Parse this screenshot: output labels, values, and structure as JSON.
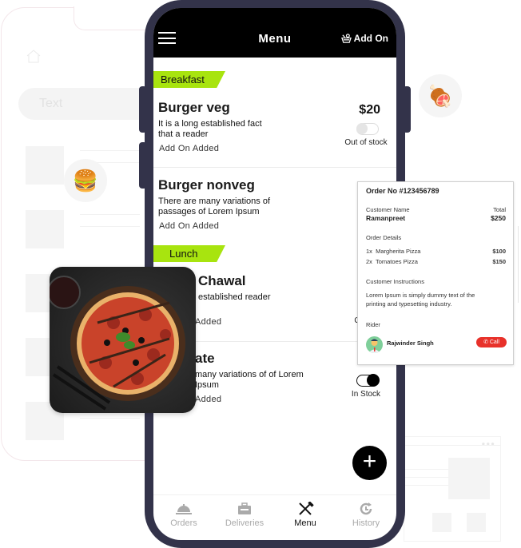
{
  "background": {
    "search_placeholder": "Text",
    "emoji_burger": "🍔",
    "emoji_meat": "🍖"
  },
  "app": {
    "title": "Menu",
    "addon_label": "Add On",
    "accent_color": "#a8e40f",
    "categories": [
      {
        "label": "Breakfast",
        "items": [
          {
            "name": "Burger veg",
            "description": "It is a long established fact that a reader",
            "addon": "Add On Added",
            "price": "$20",
            "in_stock": false,
            "stock_label": "Out of stock"
          },
          {
            "name": "Burger nonveg",
            "description": "There are many variations of passages of Lorem Ipsum",
            "addon": "Add On Added",
            "price": "",
            "in_stock": null,
            "stock_label": ""
          }
        ]
      },
      {
        "label": "Lunch",
        "items": [
          {
            "name": "Chawal",
            "description": "established reader",
            "addon": "Added",
            "price": "",
            "in_stock": false,
            "stock_label": "Ou"
          },
          {
            "name": "ate",
            "description": "many variations of of Lorem Ipsum",
            "addon": "Added",
            "price": "",
            "in_stock": true,
            "stock_label": "In Stock"
          }
        ]
      }
    ],
    "fab_label": "+",
    "bottom_nav": [
      {
        "label": "Orders",
        "icon": "cloche-icon",
        "active": false
      },
      {
        "label": "Deliveries",
        "icon": "toolbox-icon",
        "active": false
      },
      {
        "label": "Menu",
        "icon": "fork-knife-icon",
        "active": true
      },
      {
        "label": "History",
        "icon": "history-icon",
        "active": false
      }
    ]
  },
  "order_card": {
    "order_no": "Order No #123456789",
    "customer_label": "Customer Name",
    "customer_name": "Ramanpreet",
    "total_label": "Total",
    "total": "$250",
    "details_label": "Order Details",
    "lines": [
      {
        "qty": "1x",
        "item": "Margherita Pizza",
        "price": "$100"
      },
      {
        "qty": "2x",
        "item": "Tomatoes Pizza",
        "price": "$150"
      }
    ],
    "instructions_label": "Customer Instructions",
    "instructions": "Lorem Ipsum is simply dummy text of the printing and typesetting industry.",
    "rider_label": "Rider",
    "rider_name": "Rajwinder Singh",
    "call_label": "Call",
    "call_color": "#e8312a"
  }
}
